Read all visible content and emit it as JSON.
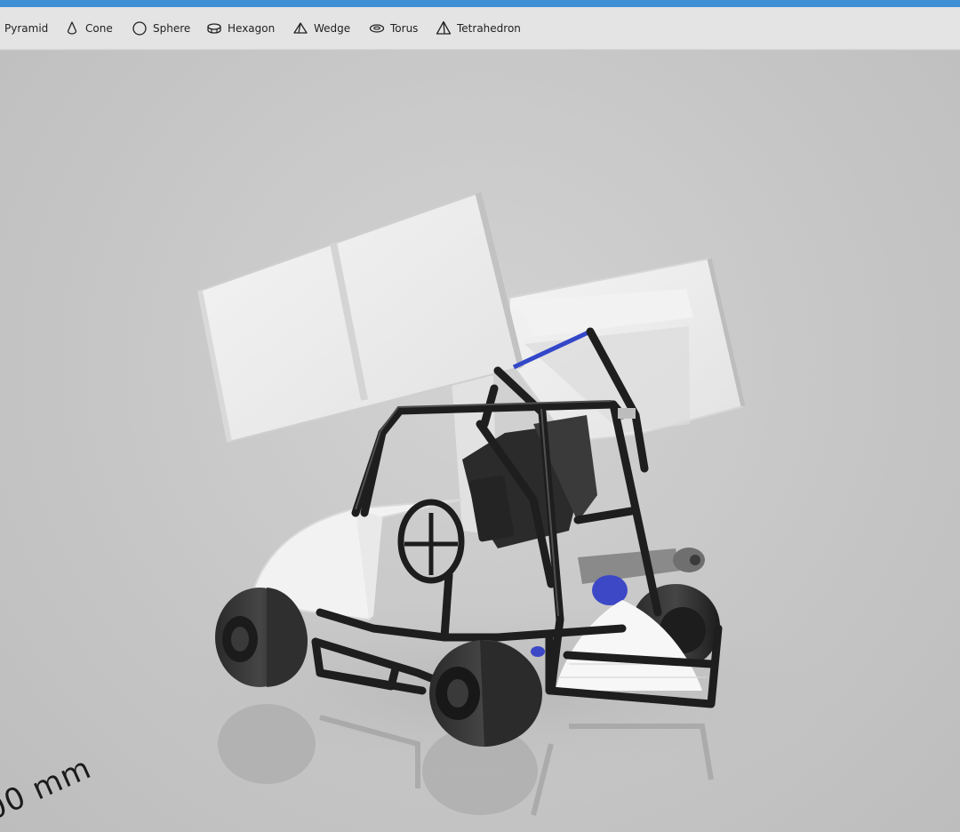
{
  "toolbar": {
    "items": [
      {
        "label": "Pyramid",
        "icon": "pyramid-icon"
      },
      {
        "label": "Cone",
        "icon": "cone-icon"
      },
      {
        "label": "Sphere",
        "icon": "sphere-icon"
      },
      {
        "label": "Hexagon",
        "icon": "hexagon-icon"
      },
      {
        "label": "Wedge",
        "icon": "wedge-icon"
      },
      {
        "label": "Torus",
        "icon": "torus-icon"
      },
      {
        "label": "Tetrahedron",
        "icon": "tetrahedron-icon"
      }
    ]
  },
  "viewport": {
    "scale_label": "00 mm"
  },
  "colors": {
    "title_bar": "#3e8fd3",
    "toolbar_bg": "#e4e4e4",
    "viewport_bg": "#c9c9c9",
    "frame": "#1e1e1e",
    "wing": "#ececec",
    "accent_blue": "#3347c9"
  }
}
